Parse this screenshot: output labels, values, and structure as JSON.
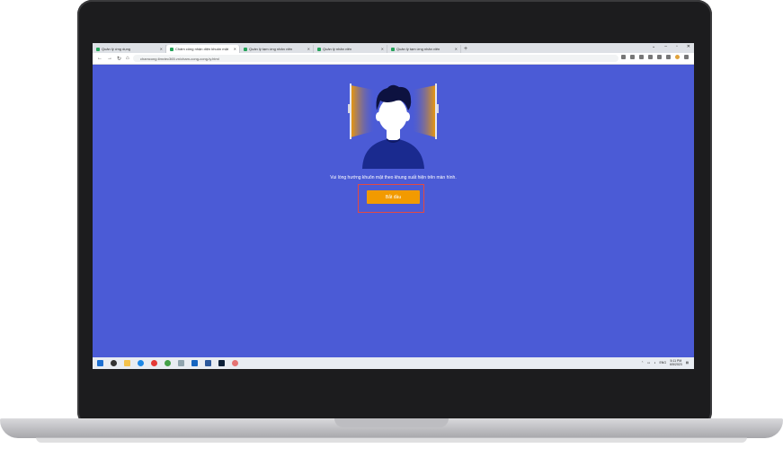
{
  "browser": {
    "tabs": [
      {
        "label": "Quản lý ứng dụng"
      },
      {
        "label": "Chấm công nhận diện khuôn mặt"
      },
      {
        "label": "Quản lý tạm ứng nhân viên"
      },
      {
        "label": "Quản lý nhân viên"
      },
      {
        "label": "Quản lý tạm ứng nhân viên"
      }
    ],
    "url": "chamcong.timviec365.vn/cham-cong-cong-ty.html"
  },
  "page": {
    "instruction": "Vui lòng hướng khuôn mặt theo khung xuất hiện trên màn hình.",
    "start_button": "Bắt đầu"
  },
  "taskbar": {
    "language": "ENG",
    "time": "5:11 PM",
    "date": "6/5/2023"
  },
  "colors": {
    "page_bg": "#4b5bd6",
    "button": "#f29a00",
    "highlight_frame": "#e5493f"
  }
}
